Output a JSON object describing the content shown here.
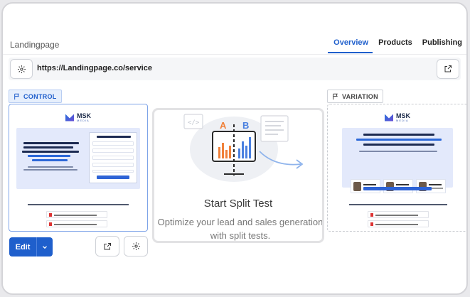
{
  "header": {
    "title": "Landingpage",
    "tabs": [
      {
        "label": "Overview",
        "active": true
      },
      {
        "label": "Products",
        "active": false
      },
      {
        "label": "Publishing",
        "active": false
      }
    ]
  },
  "urlbar": {
    "url": "https://Landingpage.co/service",
    "settings_icon": "gear-icon",
    "open_icon": "external-link-icon"
  },
  "control": {
    "tag_label": "CONTROL",
    "edit_label": "Edit",
    "preview": {
      "logo_text": "MSK",
      "logo_sub": "MEDIA"
    }
  },
  "variation": {
    "tag_label": "VARIATION",
    "preview": {
      "logo_text": "MSK",
      "logo_sub": "MEDIA"
    }
  },
  "split_test": {
    "title": "Start Split Test",
    "description": "Optimize your lead and sales generation with split tests.",
    "illustration_letters": [
      "A",
      "B"
    ]
  },
  "colors": {
    "accent": "#1f5fcc",
    "accent_light": "#e6effc",
    "border": "#cfd2d8"
  }
}
